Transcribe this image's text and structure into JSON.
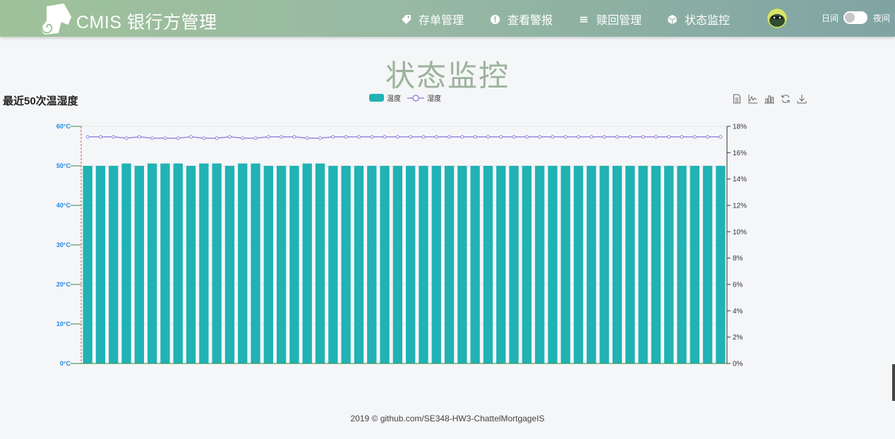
{
  "app": {
    "brand": "CMIS 银行方管理"
  },
  "nav": {
    "items": [
      {
        "label": "存单管理",
        "icon": "tag-icon"
      },
      {
        "label": "查看警报",
        "icon": "alert-icon"
      },
      {
        "label": "赎回管理",
        "icon": "menu-icon"
      },
      {
        "label": "状态监控",
        "icon": "cube-icon"
      }
    ]
  },
  "theme": {
    "day_label": "日间",
    "night_label": "夜间",
    "mode": "day"
  },
  "page": {
    "title": "状态监控"
  },
  "footer": {
    "text": "2019 © github.com/SE348-HW3-ChattelMortgageIS"
  },
  "colors": {
    "bar": "#20b2b4",
    "line": "#9b86e0",
    "left_axis_text": "#1e88e5",
    "left_axis_line": "#2e8b3d",
    "mark_line": "#e05050"
  },
  "chart_data": {
    "type": "bar",
    "title": "最近50次温湿度",
    "legend": {
      "position": "top-center",
      "entries": [
        "温度",
        "湿度"
      ]
    },
    "x_count": 50,
    "grid": true,
    "y_left": {
      "ylim": [
        0,
        60
      ],
      "ticks": [
        "0°C",
        "10°C",
        "20°C",
        "30°C",
        "40°C",
        "50°C",
        "60°C"
      ]
    },
    "y_right": {
      "ylim": [
        0,
        18
      ],
      "ticks": [
        "0%",
        "2%",
        "4%",
        "6%",
        "8%",
        "10%",
        "12%",
        "14%",
        "16%",
        "18%"
      ]
    },
    "series": [
      {
        "name": "温度",
        "type": "bar",
        "axis": "left",
        "values": [
          50,
          50,
          50,
          50.6,
          50,
          50.6,
          50.6,
          50.6,
          50,
          50.6,
          50.6,
          50,
          50.6,
          50.6,
          50,
          50,
          50,
          50.6,
          50.6,
          50,
          50,
          50,
          50,
          50,
          50,
          50,
          50,
          50,
          50,
          50,
          50,
          50,
          50,
          50,
          50,
          50,
          50,
          50,
          50,
          50,
          50,
          50,
          50,
          50,
          50,
          50,
          50,
          50,
          50,
          50
        ]
      },
      {
        "name": "湿度",
        "type": "line",
        "axis": "right",
        "values": [
          17.2,
          17.2,
          17.2,
          17.1,
          17.2,
          17.1,
          17.1,
          17.1,
          17.2,
          17.1,
          17.1,
          17.2,
          17.1,
          17.1,
          17.2,
          17.2,
          17.2,
          17.1,
          17.1,
          17.2,
          17.2,
          17.2,
          17.2,
          17.2,
          17.2,
          17.2,
          17.2,
          17.2,
          17.2,
          17.2,
          17.2,
          17.2,
          17.2,
          17.2,
          17.2,
          17.2,
          17.2,
          17.2,
          17.2,
          17.2,
          17.2,
          17.2,
          17.2,
          17.2,
          17.2,
          17.2,
          17.2,
          17.2,
          17.2,
          17.2
        ]
      }
    ]
  },
  "toolbox": [
    "data-view-icon",
    "line-chart-icon",
    "bar-chart-icon",
    "restore-icon",
    "download-icon"
  ]
}
